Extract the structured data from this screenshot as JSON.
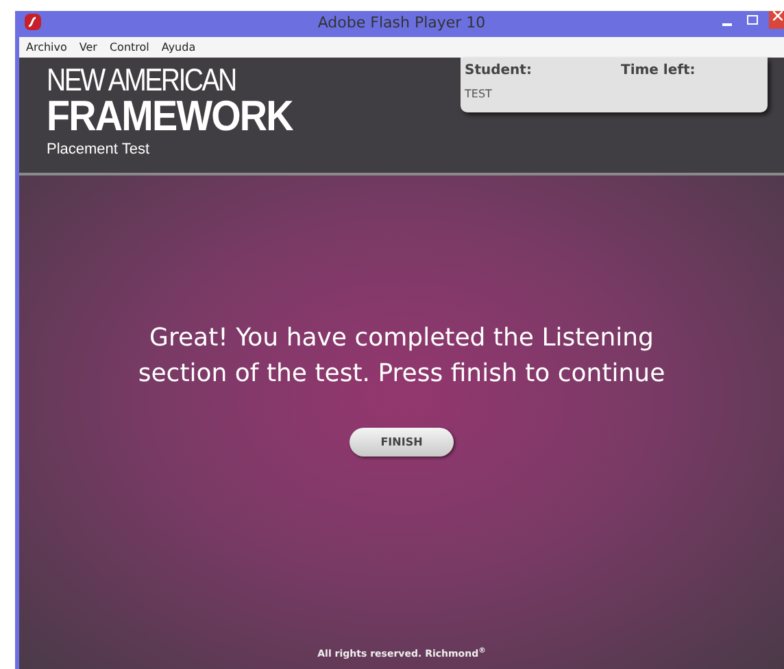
{
  "window": {
    "title": "Adobe Flash Player 10"
  },
  "menu": [
    "Archivo",
    "Ver",
    "Control",
    "Ayuda"
  ],
  "header": {
    "brand_line_1": "NEW AMERICAN",
    "brand_line_2": "FRAMEWORK",
    "subtitle": "Placement Test"
  },
  "info_panel": {
    "student_label": "Student:",
    "time_label": "Time left:",
    "student_value": "TEST"
  },
  "message": "Great! You have completed the Listening section of the test. Press finish to continue",
  "finish_button": "FINISH",
  "footer": "All rights reserved. Richmond$^{®}$"
}
